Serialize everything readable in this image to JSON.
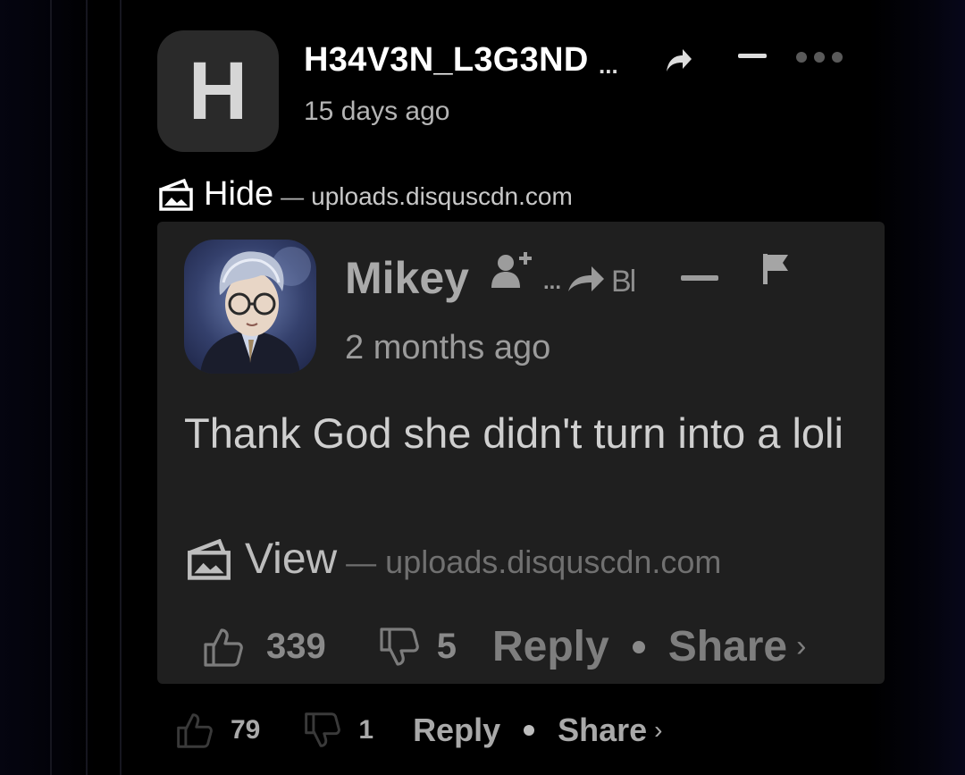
{
  "comment": {
    "avatar_letter": "H",
    "username": "H34V3N_L3G3ND",
    "username_more": "...",
    "timestamp": "15 days ago",
    "media": {
      "toggle_label": "Hide",
      "dash": "—",
      "source_host": "uploads.disquscdn.com"
    },
    "actions": {
      "upvotes": "79",
      "downvotes": "1",
      "reply_label": "Reply",
      "share_label": "Share",
      "share_chevron": "›"
    }
  },
  "embedded_comment": {
    "username": "Mikey",
    "menu_more": "...",
    "truncated_label": "Bl",
    "timestamp": "2 months ago",
    "body": "Thank God she didn't turn into a loli",
    "media": {
      "toggle_label": "View",
      "dash": "—",
      "source_host": "uploads.disquscdn.com"
    },
    "actions": {
      "upvotes": "339",
      "downvotes": "5",
      "reply_label": "Reply",
      "share_label": "Share",
      "share_chevron": "›"
    }
  },
  "colors": {
    "background": "#000000",
    "embed_background": "#1f1f1f",
    "avatar_background": "#2a2a2a"
  }
}
